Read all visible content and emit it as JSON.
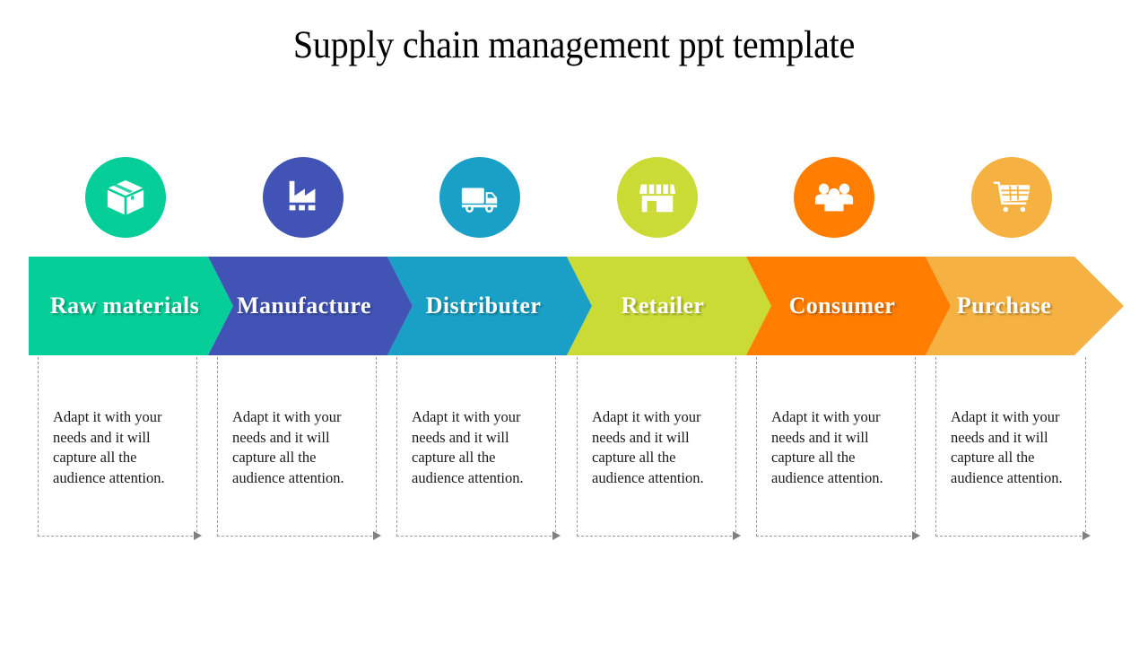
{
  "title": "Supply chain management ppt template",
  "background_color": "#ffffff",
  "stages": [
    {
      "label": "Raw materials",
      "icon": "box-icon",
      "color": "#05CE98",
      "description": "Adapt it with your needs and it will capture all the audience attention."
    },
    {
      "label": "Manufacture",
      "icon": "factory-icon",
      "color": "#4154B5",
      "description": "Adapt it with your needs and it will capture all the audience attention."
    },
    {
      "label": "Distributer",
      "icon": "delivery-truck-icon",
      "color": "#1AA0C6",
      "description": "Adapt it with your needs and it will capture all the audience attention."
    },
    {
      "label": "Retailer",
      "icon": "storefront-icon",
      "color": "#CBDB36",
      "description": "Adapt it with your needs and it will capture all the audience attention."
    },
    {
      "label": "Consumer",
      "icon": "people-group-icon",
      "color": "#FF7D00",
      "description": "Adapt it with your needs and it will capture all the audience attention."
    },
    {
      "label": "Purchase",
      "icon": "shopping-cart-icon",
      "color": "#F5B243",
      "description": "Adapt it with your needs and it will capture all the audience attention."
    }
  ]
}
